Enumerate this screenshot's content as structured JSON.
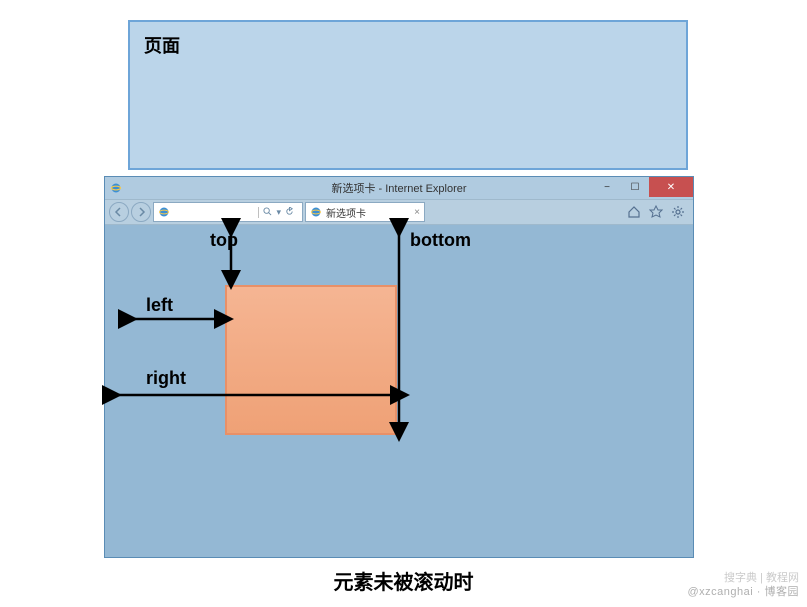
{
  "page": {
    "label": "页面"
  },
  "window": {
    "title": "新选项卡 - Internet Explorer",
    "tab_label": "新选项卡",
    "search_hint": "搜",
    "min": "−",
    "max": "☐",
    "close": "✕"
  },
  "labels": {
    "top": "top",
    "bottom": "bottom",
    "left": "left",
    "right": "right"
  },
  "caption": "元素未被滚动时",
  "watermark": "@xzcanghai · 博客园",
  "watermark2": "搜字典 | 教程网"
}
